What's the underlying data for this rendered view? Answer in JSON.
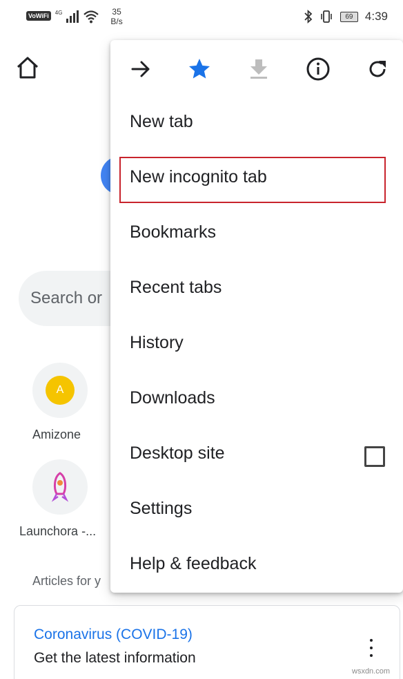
{
  "status_bar": {
    "vowifi": "VoWiFi",
    "network": "4G",
    "speed_value": "35",
    "speed_unit": "B/s",
    "battery": "69",
    "time": "4:39"
  },
  "background": {
    "search_placeholder": "Search or",
    "tiles": [
      {
        "letter": "A",
        "label": "Amizone",
        "color": "#f5c400"
      },
      {
        "label": "Launchora -..."
      }
    ],
    "articles_heading": "Articles for y",
    "article": {
      "title": "Coronavirus (COVID-19)",
      "subtitle": "Get the latest information"
    }
  },
  "menu": {
    "toolbar_icons": [
      "forward-icon",
      "bookmark-star-icon",
      "download-icon",
      "info-icon",
      "refresh-icon"
    ],
    "items": [
      {
        "label": "New tab"
      },
      {
        "label": "New incognito tab",
        "highlighted": true
      },
      {
        "label": "Bookmarks"
      },
      {
        "label": "Recent tabs"
      },
      {
        "label": "History"
      },
      {
        "label": "Downloads"
      },
      {
        "label": "Desktop site",
        "checked": false
      },
      {
        "label": "Settings"
      },
      {
        "label": "Help & feedback"
      }
    ],
    "highlight_color": "#c8232c",
    "star_color": "#1a73e8"
  },
  "watermark": "wsxdn.com"
}
